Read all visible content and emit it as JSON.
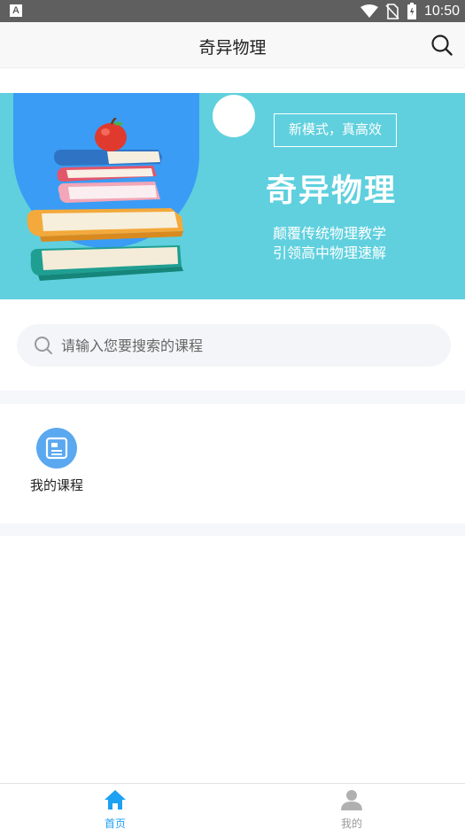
{
  "status_bar": {
    "notification_glyph": "A",
    "time": "10:50",
    "icons": [
      "wifi-icon",
      "no-sim-icon",
      "battery-icon"
    ]
  },
  "app_bar": {
    "title": "奇异物理",
    "search_icon": "search-icon"
  },
  "banner": {
    "tag": "新模式，真高效",
    "title": "奇异物理",
    "subtitle_line1": "颠覆传统物理教学",
    "subtitle_line2": "引领高中物理速解",
    "colors": {
      "background": "#60d0de",
      "arch": "#3a9cf5"
    }
  },
  "search": {
    "placeholder": "请输入您要搜索的课程",
    "value": ""
  },
  "entries": [
    {
      "label": "我的课程",
      "icon": "course-list-icon"
    }
  ],
  "tab_bar": {
    "items": [
      {
        "label": "首页",
        "icon": "home-icon",
        "active": true
      },
      {
        "label": "我的",
        "icon": "user-icon",
        "active": false
      }
    ],
    "active_color": "#1da1f2",
    "inactive_color": "#999999"
  }
}
